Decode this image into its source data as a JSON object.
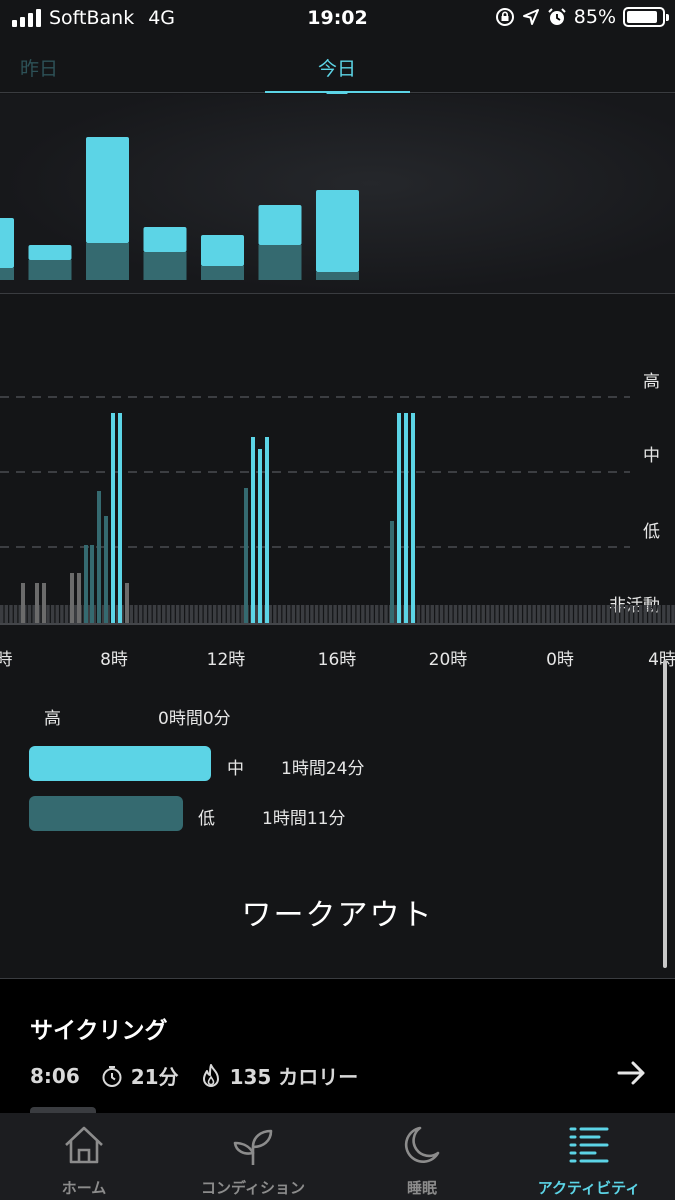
{
  "status_bar": {
    "carrier": "SoftBank",
    "network": "4G",
    "time": "19:02",
    "battery": "85%"
  },
  "tabs": {
    "yesterday": "昨日",
    "today": "今日"
  },
  "hourly_chart": {
    "note_colors": {
      "mid": "#5cd4e6",
      "low": "#356a70"
    },
    "bars": [
      {
        "low": 12,
        "mid": 50
      },
      {
        "low": 20,
        "mid": 15
      },
      {
        "low": 37,
        "mid": 106
      },
      {
        "low": 28,
        "mid": 25
      },
      {
        "low": 14,
        "mid": 31
      },
      {
        "low": 35,
        "mid": 40
      },
      {
        "low": 8,
        "mid": 82
      }
    ]
  },
  "intensity_chart": {
    "level_labels": {
      "high": "高",
      "mid": "中",
      "low": "低",
      "inactive": "非活動"
    },
    "hour_labels": [
      "時",
      "8時",
      "12時",
      "16時",
      "20時",
      "0時",
      "4時"
    ],
    "colors": {
      "inactive": "#3b3d41",
      "grey": "#6b6b6b",
      "low": "#356a70",
      "mid": "#5cd4e6"
    }
  },
  "legend": {
    "high": {
      "label": "高",
      "duration": "0時間0分"
    },
    "mid": {
      "label": "中",
      "duration": "1時間24分"
    },
    "low": {
      "label": "低",
      "duration": "1時間11分"
    }
  },
  "workout_title": "ワークアウト",
  "workout": {
    "name": "サイクリング",
    "start": "8:06",
    "duration": "21分",
    "calories": "135 カロリー"
  },
  "nav": {
    "home": "ホーム",
    "condition": "コンディション",
    "sleep": "睡眠",
    "activity": "アクティビティ"
  }
}
